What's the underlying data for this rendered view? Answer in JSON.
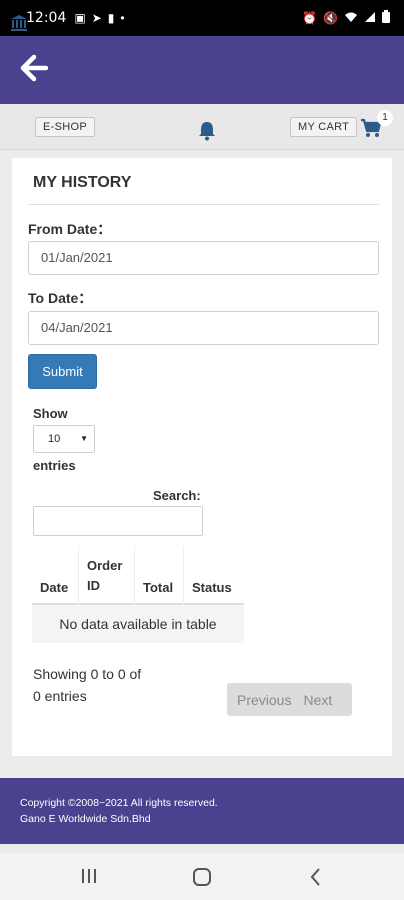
{
  "status_bar": {
    "time": "12:04",
    "notification_icons": [
      "image-icon",
      "telegram-icon",
      "message-icon",
      "dot-icon"
    ],
    "system_icons": [
      "alarm-icon",
      "mute-icon",
      "wifi-icon",
      "signal-icon",
      "battery-icon"
    ]
  },
  "app_bar": {
    "background_color": "#4a418f",
    "back_icon": "back-arrow-icon"
  },
  "toolbar": {
    "eshop_label": "E-SHOP",
    "cart_label": "MY CART",
    "cart_count": "1",
    "icons": [
      "bank-icon",
      "bell-icon",
      "cart-icon"
    ],
    "icon_color": "#2d5c8a"
  },
  "page": {
    "title": "MY HISTORY",
    "from_label": "From Date：",
    "from_value": "01/Jan/2021",
    "to_label": "To Date：",
    "to_value": "04/Jan/2021",
    "submit_label": "Submit"
  },
  "table_controls": {
    "show_label": "Show",
    "entries_value": "10",
    "entries_label": "entries",
    "search_label": "Search:",
    "search_value": ""
  },
  "table": {
    "columns": [
      "Date",
      "Order ID",
      "Total",
      "Status"
    ],
    "empty_message": "No data available in table"
  },
  "pagination": {
    "info": "Showing 0 to 0 of 0 entries",
    "previous_label": "Previous",
    "next_label": "Next"
  },
  "footer": {
    "copyright": "Copyright ©2008~2021 All rights reserved.",
    "company": "Gano E Worldwide Sdn.Bhd",
    "background_color": "#4a418f"
  },
  "nav_bar": {
    "icons": [
      "recents-icon",
      "home-icon",
      "back-icon"
    ]
  }
}
